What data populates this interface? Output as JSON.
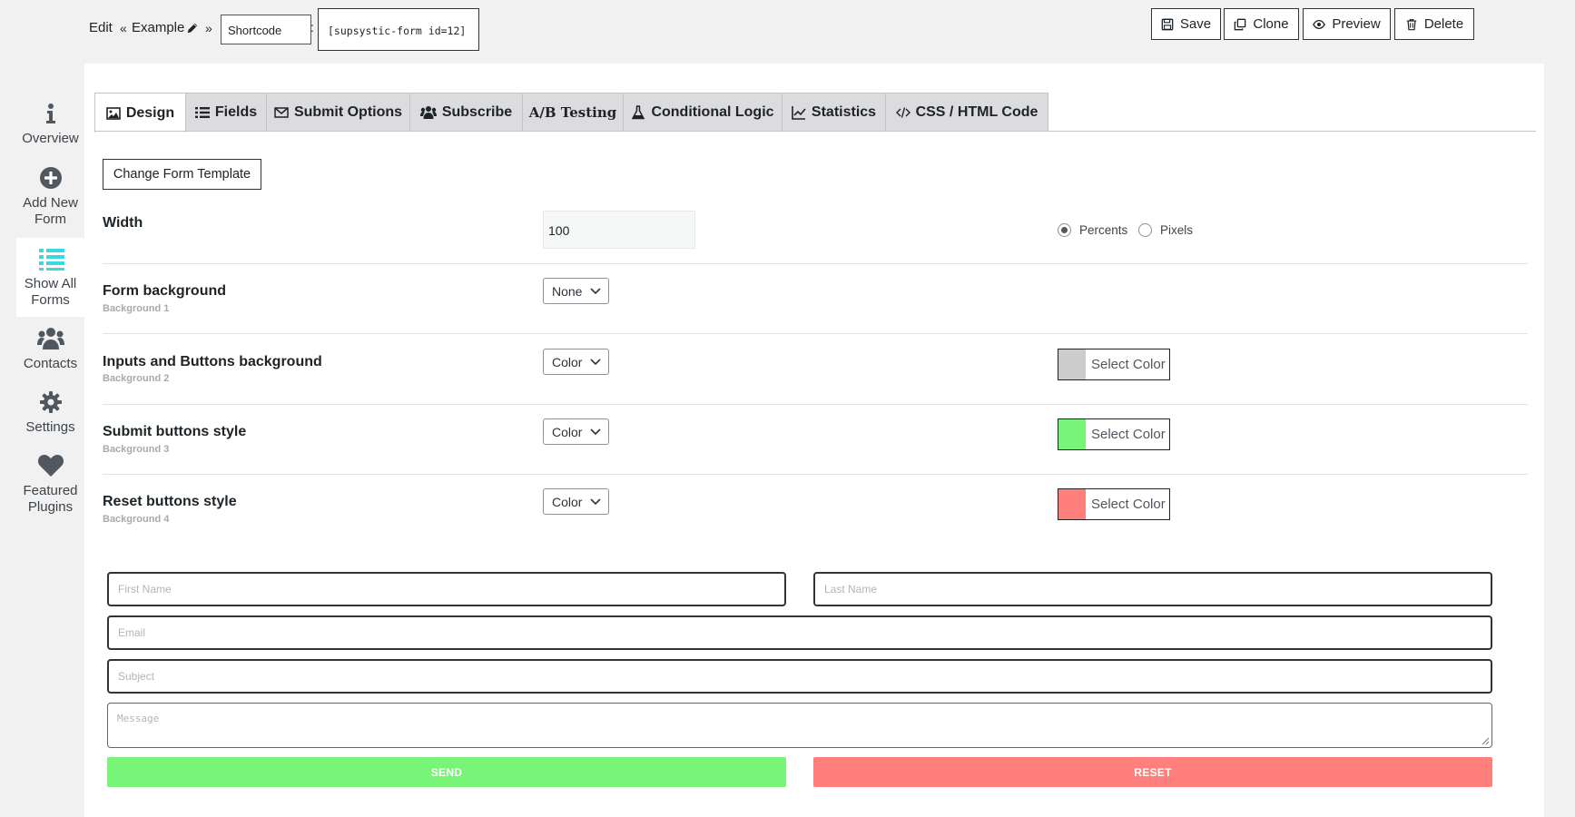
{
  "breadcrumb": {
    "edit": "Edit",
    "sep1": "«",
    "form_name": "Example",
    "sep2": "»",
    "shortcode_label": "Shortcode",
    "colon": ":",
    "shortcode_value": "[supsystic-form id=12]"
  },
  "actions": {
    "save": "Save",
    "clone": "Clone",
    "preview": "Preview",
    "delete": "Delete"
  },
  "sidebar": {
    "items": [
      {
        "line1": "Overview",
        "line2": "",
        "icon": "info-icon"
      },
      {
        "line1": "Add New",
        "line2": "Form",
        "icon": "plus-circle-icon"
      },
      {
        "line1": "Show All",
        "line2": "Forms",
        "icon": "list-icon"
      },
      {
        "line1": "Contacts",
        "line2": "",
        "icon": "users-icon"
      },
      {
        "line1": "Settings",
        "line2": "",
        "icon": "gear-icon"
      },
      {
        "line1": "Featured",
        "line2": "Plugins",
        "icon": "heart-icon"
      }
    ],
    "active_index": 2,
    "accent_color": "#3bd8e2"
  },
  "tabs": [
    {
      "label": "Design",
      "icon": "image-icon",
      "active": true
    },
    {
      "label": "Fields",
      "icon": "list-icon"
    },
    {
      "label": "Submit Options",
      "icon": "envelope-icon"
    },
    {
      "label": "Subscribe",
      "icon": "users-icon"
    },
    {
      "label": "A/B Testing",
      "icon": "ab-icon"
    },
    {
      "label": "Conditional Logic",
      "icon": "flask-icon"
    },
    {
      "label": "Statistics",
      "icon": "chart-line-icon"
    },
    {
      "label": "CSS / HTML Code",
      "icon": "code-icon"
    }
  ],
  "design": {
    "change_template": "Change Form Template",
    "width": {
      "label": "Width",
      "value": "100",
      "unit_options": [
        "Percents",
        "Pixels"
      ],
      "selected_unit": "Percents"
    },
    "rows": [
      {
        "label": "Form background",
        "sub": "Background 1",
        "select": "None"
      },
      {
        "label": "Inputs and Buttons background",
        "sub": "Background 2",
        "select": "Color",
        "picker": "Select Color",
        "color": "#cccccc"
      },
      {
        "label": "Submit buttons style",
        "sub": "Background 3",
        "select": "Color",
        "picker": "Select Color",
        "color": "#78f578"
      },
      {
        "label": "Reset buttons style",
        "sub": "Background 4",
        "select": "Color",
        "picker": "Select Color",
        "color": "#ff7f7c"
      }
    ]
  },
  "preview": {
    "first_name": "First Name",
    "last_name": "Last Name",
    "email": "Email",
    "subject": "Subject",
    "message": "Message",
    "send": "SEND",
    "reset": "RESET",
    "send_color": "#78f578",
    "reset_color": "#ff7f7c"
  }
}
